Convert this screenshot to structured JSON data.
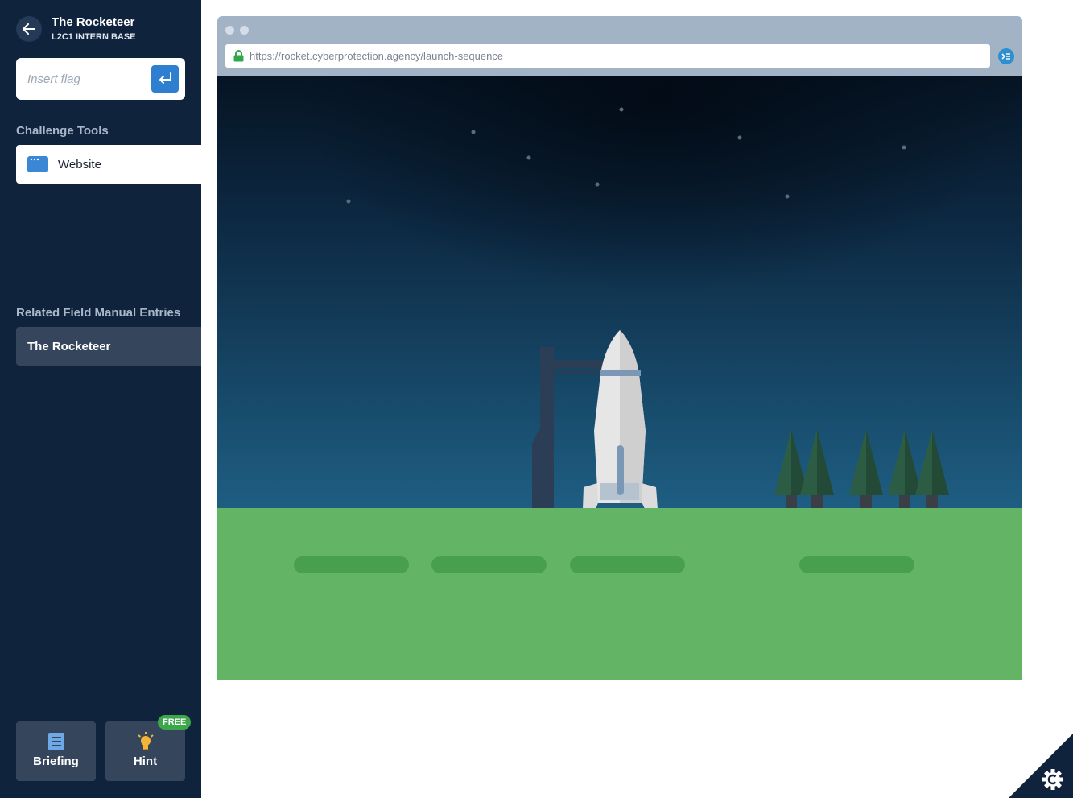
{
  "challenge": {
    "title": "The Rocketeer",
    "subtitle": "L2C1 INTERN BASE"
  },
  "flag": {
    "placeholder": "Insert flag",
    "value": ""
  },
  "tools": {
    "heading": "Challenge Tools",
    "items": [
      {
        "label": "Website",
        "icon": "browser-window-icon"
      }
    ]
  },
  "manual": {
    "heading": "Related Field Manual Entries",
    "items": [
      {
        "label": "The Rocketeer"
      }
    ]
  },
  "bottom": {
    "briefing_label": "Briefing",
    "hint_label": "Hint",
    "hint_badge": "FREE"
  },
  "browser": {
    "url": "https://rocket.cyberprotection.agency/launch-sequence"
  },
  "colors": {
    "sidebar": "#10233d",
    "accent": "#2f7fd1",
    "sky_top": "#061424",
    "sky_bottom": "#1e5e82",
    "grass": "#64b465",
    "free_badge": "#3ca64b"
  }
}
